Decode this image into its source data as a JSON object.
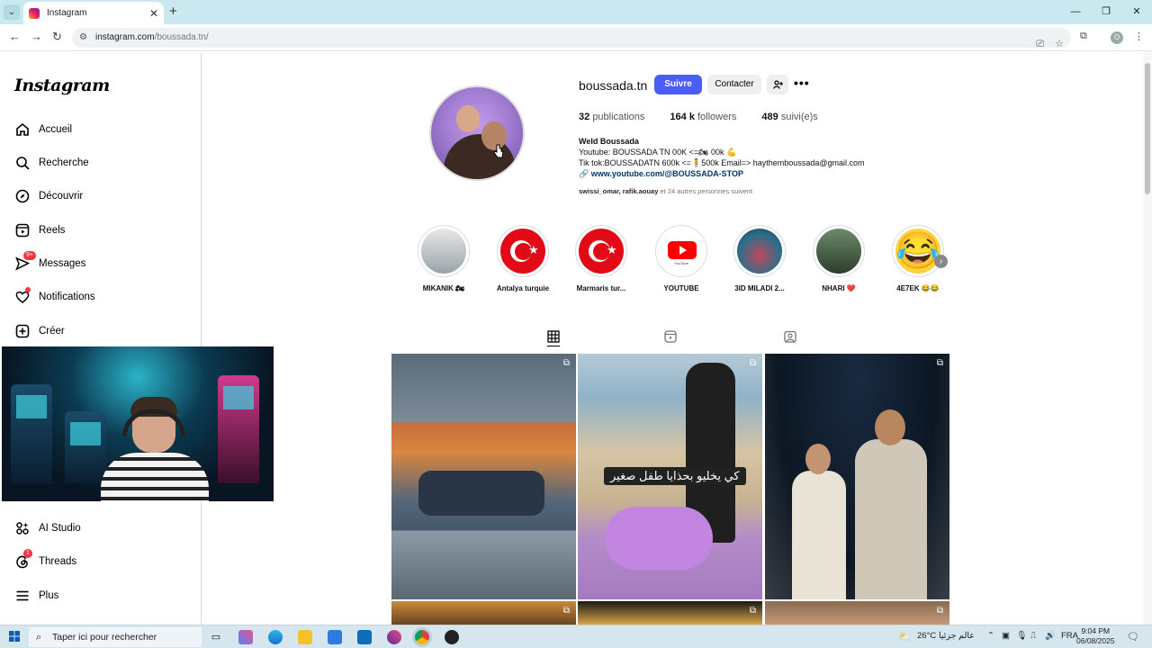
{
  "browser": {
    "tab_title": "Instagram",
    "tab_close": "✕",
    "new_tab": "+",
    "url_domain": "instagram.com",
    "url_path": "/boussada.tn/",
    "profile_initial": "O",
    "window_controls": {
      "minimize": "—",
      "maximize": "❐",
      "close": "✕"
    }
  },
  "sidebar": {
    "logo": "Instagram",
    "items_top": [
      {
        "label": "Accueil",
        "icon": "home-icon"
      },
      {
        "label": "Recherche",
        "icon": "search-icon"
      },
      {
        "label": "Découvrir",
        "icon": "explore-icon"
      },
      {
        "label": "Reels",
        "icon": "reels-icon"
      },
      {
        "label": "Messages",
        "icon": "messages-icon",
        "badge": "9+"
      },
      {
        "label": "Notifications",
        "icon": "heart-icon"
      },
      {
        "label": "Créer",
        "icon": "plus-icon"
      }
    ],
    "items_bottom": [
      {
        "label": "AI Studio",
        "icon": "ai-studio-icon"
      },
      {
        "label": "Threads",
        "icon": "threads-icon",
        "badge": "1"
      },
      {
        "label": "Plus",
        "icon": "menu-icon"
      }
    ]
  },
  "profile": {
    "username": "boussada.tn",
    "follow_label": "Suivre",
    "contact_label": "Contacter",
    "add_label": "+👤",
    "more_label": "•••",
    "posts_count": "32",
    "posts_label": "publications",
    "followers_count": "164 k",
    "followers_label": "followers",
    "following_count": "489",
    "following_label": "suivi(e)s",
    "display_name": "Weld Boussada",
    "bio_line1": "Youtube: BOUSSADA TN 00K <=🏍 00k 💪",
    "bio_line2": "Tik tok:BOUSSADATN 600k <=🧍500k Email=> haythemboussada@gmail.com",
    "link_icon": "🔗",
    "link": "www.youtube.com/@BOUSSADA-STOP",
    "followed_by_users": "swissi_omar, rafik.aouay",
    "followed_by_rest": " et 24 autres personnes suivent"
  },
  "highlights": [
    {
      "label": "MIKANIK 🏍"
    },
    {
      "label": "Antalya turquie"
    },
    {
      "label": "Marmaris tur..."
    },
    {
      "label": "YOUTUBE",
      "caption": "YouTube"
    },
    {
      "label": "3ID MILADI 2..."
    },
    {
      "label": "NHARI ❤️"
    },
    {
      "label": "4E7EK 😂😂",
      "emoji": "😂"
    }
  ],
  "highlight_next": "›",
  "posts": {
    "subtitle": "كي يخليو بحذايا طفل صغير",
    "post_icons": [
      "⧉",
      "⧉",
      "⧉"
    ]
  },
  "taskbar": {
    "search_placeholder": "Taper ici pour rechercher",
    "weather": "26°C",
    "weather_text": "عالم جزئيا",
    "lang": "FRA",
    "time": "9:04 PM",
    "date": "06/08/2025"
  }
}
